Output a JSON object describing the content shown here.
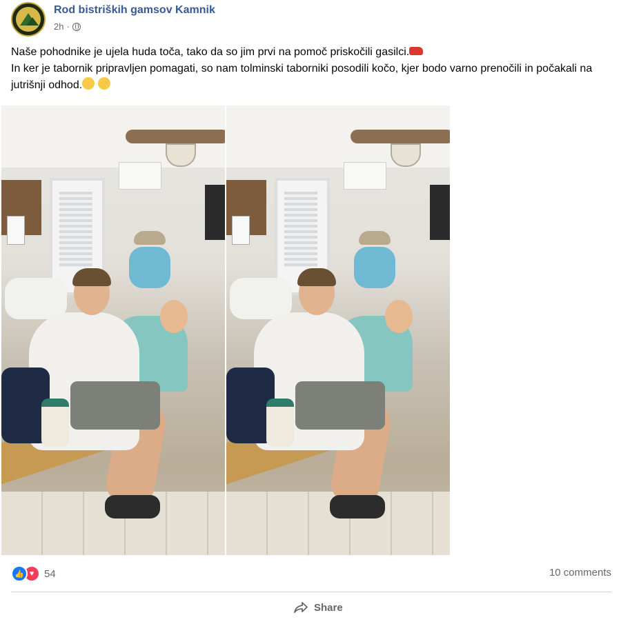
{
  "post": {
    "page_name": "Rod bistriških gamsov Kamnik",
    "time": "2h",
    "privacy_icon": "globe-icon",
    "text_line1": "Naše pohodnike je ujela huda toča, tako da so jim prvi na pomoč priskočili gasilci.",
    "text_line1_emoji": "fire-engine-emoji",
    "text_line2": "In ker je tabornik pripravljen pomagati, so nam tolminski taborniki posodili kočo, kjer bodo varno prenočili in počakali na jutrišnji odhod.",
    "text_line2_emojis": [
      "grinning-sweat-emoji",
      "relieved-face-emoji"
    ]
  },
  "photos": [
    {
      "alt": "Group of scouts sitting in a hut"
    },
    {
      "alt": "Group of scouts sitting in a hut"
    }
  ],
  "footer": {
    "reaction_icons": [
      "like-icon",
      "love-icon"
    ],
    "reaction_count": "54",
    "comments_label": "10 comments",
    "share_label": "Share"
  },
  "colors": {
    "page_name": "#385898",
    "meta": "#65676b",
    "like": "#1877f2",
    "love": "#f33e58"
  }
}
